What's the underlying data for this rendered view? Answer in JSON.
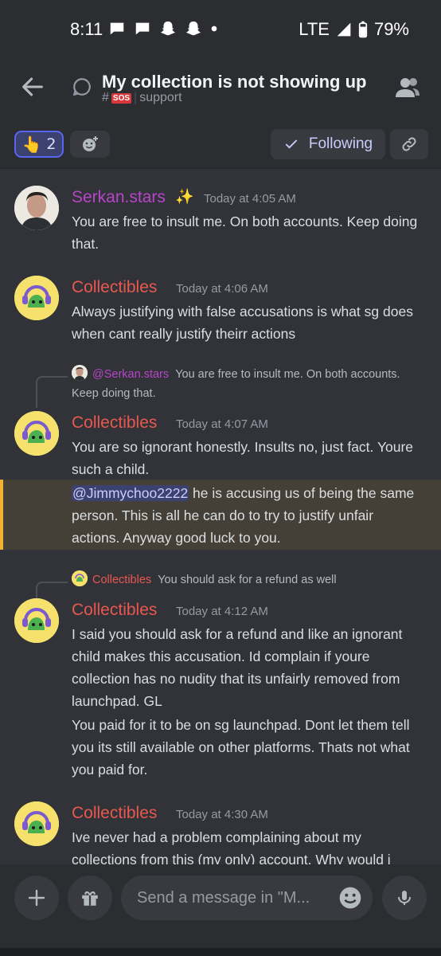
{
  "status_bar": {
    "time": "8:11",
    "network": "LTE",
    "battery": "79%"
  },
  "header": {
    "title": "My collection is not showing up",
    "channel_emoji": "SOS",
    "channel_prefix": "#",
    "channel_name": "support"
  },
  "reactions": {
    "count": "2",
    "follow_label": "Following"
  },
  "messages": [
    {
      "author": "Serkan.stars",
      "time": "Today at 4:05 AM",
      "lines": [
        "You are free to insult me. On both accounts. Keep doing that."
      ]
    },
    {
      "author": "Collectibles",
      "time": "Today at 4:06 AM",
      "lines": [
        "Always justifying with false accusations is what sg does when cant really justify theirr actions"
      ]
    },
    {
      "reply_author": "@Serkan.stars",
      "reply_text": "You are free to insult me. On both accounts. Keep doing that.",
      "author": "Collectibles",
      "time": "Today at 4:07 AM",
      "lines": [
        "You are so ignorant honestly. Insults no, just fact. Youre such a child."
      ],
      "mention": "@Jimmychoo2222",
      "mention_text": " he is accusing us of being the same person. This is all he can do to try to justify unfair actions. Anyway good luck to you."
    },
    {
      "reply_author": "Collectibles",
      "reply_text": "You should ask for a refund as well",
      "author": "Collectibles",
      "time": "Today at 4:12 AM",
      "lines": [
        "I said you should ask for a refund and like an ignorant child  makes this accusation. Id complain if youre collection has no nudity that its unfairly removed from launchpad. GL",
        "You paid for it to be on sg launchpad. Dont let them tell you its still available on other platforms. Thats not what you paid for."
      ]
    },
    {
      "author": "Collectibles",
      "time": "Today at 4:30 AM",
      "lines": [
        "Ive never had a problem complaining about my collections from this (my only) account. Why would i"
      ]
    }
  ],
  "composer": {
    "placeholder": "Send a message in \"M..."
  },
  "colors": {
    "serkan": "#b845c9",
    "collectibles": "#e8584f",
    "accent": "#5865f2"
  }
}
